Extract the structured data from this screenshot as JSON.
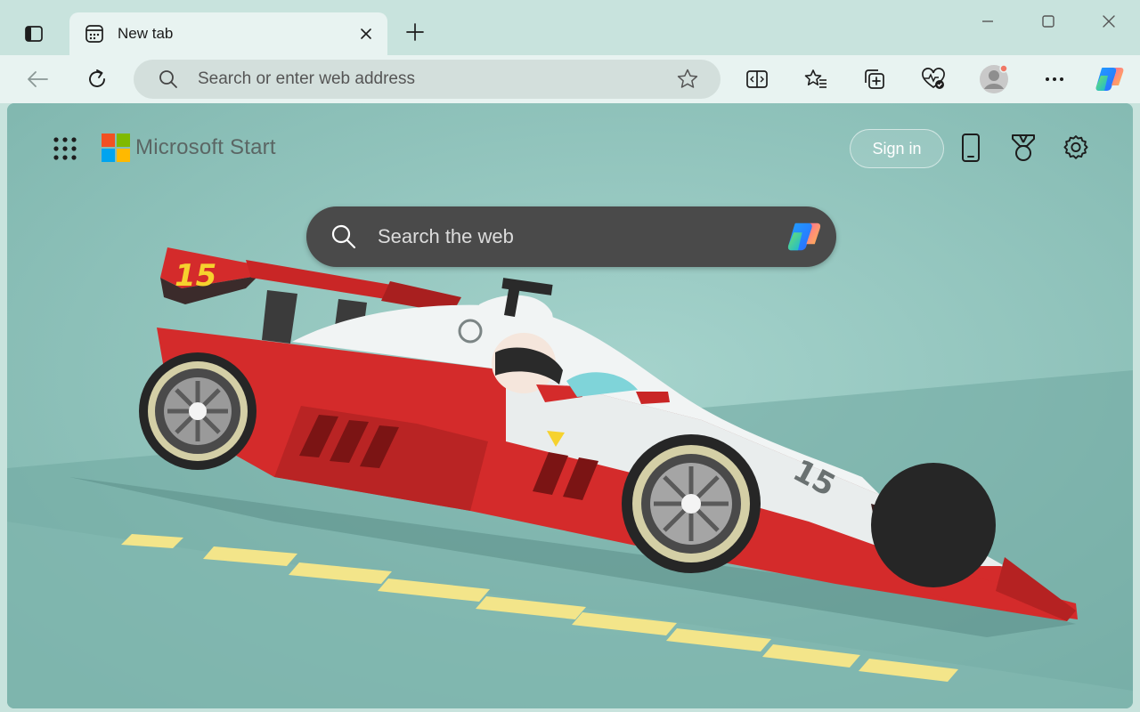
{
  "tabstrip": {
    "tab_title": "New tab"
  },
  "toolbar": {
    "address_placeholder": "Search or enter web address"
  },
  "newtab": {
    "brand": "Microsoft Start",
    "signin_label": "Sign in",
    "search_placeholder": "Search the web",
    "car_number": "15"
  },
  "icons": {
    "tab_actions": "tab-actions-icon",
    "favicon": "newtab-icon",
    "close_tab": "close-icon",
    "new_tab": "plus-icon",
    "minimize": "minimize-icon",
    "maximize": "maximize-icon",
    "close_window": "close-icon",
    "back": "back-arrow-icon",
    "refresh": "refresh-icon",
    "search": "search-icon",
    "favorite": "star-icon",
    "split_screen": "split-screen-icon",
    "favorites": "favorites-icon",
    "collections": "collections-icon",
    "browser_essentials": "heart-pulse-icon",
    "profile": "profile-avatar-icon",
    "more": "more-icon",
    "copilot": "copilot-icon",
    "apps": "apps-grid-icon",
    "phone": "phone-icon",
    "rewards": "rewards-icon",
    "settings": "gear-icon"
  },
  "colors": {
    "frame": "#c8e3dd",
    "toolbar": "#e8f3f1",
    "address_bar": "#d3dfdc",
    "search_box": "#4a4a4a",
    "car_red": "#d42b2b",
    "track_background": "#8fc2ba",
    "lane_marking": "#f3e58a"
  }
}
